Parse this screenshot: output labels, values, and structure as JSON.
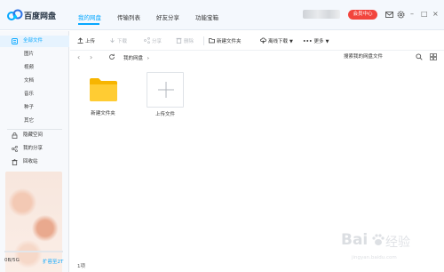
{
  "app": {
    "name": "百度网盘",
    "brand_color": "#06a7ff",
    "nav_tabs": [
      {
        "label": "我的网盘",
        "active": true
      },
      {
        "label": "传输列表",
        "active": false
      },
      {
        "label": "好友分享",
        "active": false
      },
      {
        "label": "功能宝箱",
        "active": false
      }
    ],
    "vip_label": "会员中心",
    "vip_color": "#f2453d",
    "icons": [
      "mail-icon",
      "gear-icon",
      "minimize-icon",
      "maximize-icon",
      "close-icon"
    ]
  },
  "sidebar": {
    "items": [
      {
        "label": "全部文件",
        "icon": "folder-icon",
        "active": true
      },
      {
        "label": "图片",
        "sub": true
      },
      {
        "label": "视频",
        "sub": true
      },
      {
        "label": "文档",
        "sub": true
      },
      {
        "label": "音乐",
        "sub": true
      },
      {
        "label": "种子",
        "sub": true
      },
      {
        "label": "其它",
        "sub": true
      },
      {
        "label": "隐藏空间",
        "icon": "lock-icon"
      },
      {
        "label": "我的分享",
        "icon": "share-icon"
      },
      {
        "label": "回收站",
        "icon": "trash-icon"
      }
    ],
    "storage_text": "0B/5G",
    "storage_used_fraction": 0.0,
    "expand_label": "扩容至2T"
  },
  "toolbar": {
    "upload": "上传",
    "download": "下载",
    "share": "分享",
    "delete": "删除",
    "new_folder": "新建文件夹",
    "offline_download": "离线下载",
    "more": "更多"
  },
  "pathbar": {
    "path": "我的网盘",
    "search_placeholder": "搜索我的网盘文件"
  },
  "files": [
    {
      "name": "新建文件夹",
      "type": "folder",
      "icon": "folder-icon"
    }
  ],
  "upload_tile_label": "上传文件",
  "status": {
    "count": "1项"
  },
  "watermark": {
    "text_a": "Bai",
    "text_b": "经验",
    "url": "jingyan.baidu.com"
  }
}
